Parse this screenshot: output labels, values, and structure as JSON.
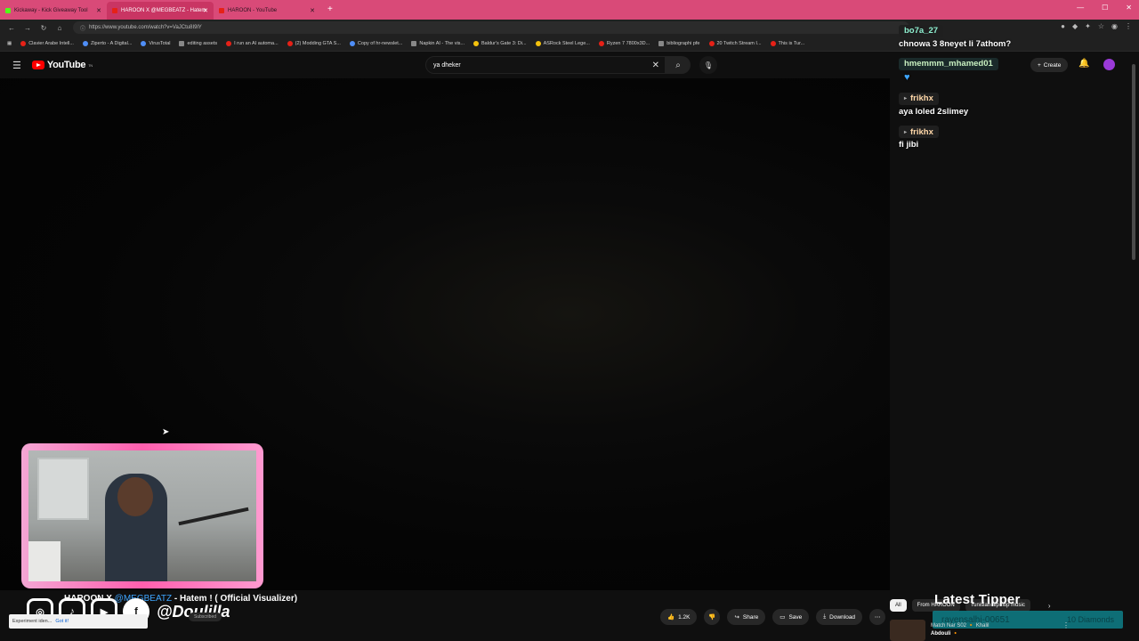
{
  "browser": {
    "tabs": [
      {
        "label": "Kickaway - Kick Giveaway Tool"
      },
      {
        "label": "HAROON X @MEGBEATZ - Hatem"
      },
      {
        "label": "HAROON - YouTube"
      }
    ],
    "url": "https://www.youtube.com/watch?v=VaJCtu8I9lY",
    "bookmarks": [
      "Clavier Arabe Intell...",
      "Ziperto - A Digital...",
      "VirusTotal",
      "editing assets",
      "I run an AI automa...",
      "(2) Modding GTA S...",
      "Copy of hr-newslet...",
      "Napkin AI - The vis...",
      "Baldur's Gate 3: Di...",
      "ASRock Steel Lege...",
      "Ryzen 7 7800x3D...",
      "bibliographi pfe",
      "20 Twitch Stream I...",
      "This is Tur..."
    ]
  },
  "youtube": {
    "logo_text": "YouTube",
    "logo_sup": "TN",
    "search_value": "ya dheker",
    "create_label": "Create"
  },
  "video": {
    "title_prefix": "HAROON X ",
    "title_tag": "@MEGBEATZ",
    "title_suffix": " - Hatem ! ( Official Visualizer)",
    "subscribe_label": "Subscribed",
    "toast_text": "Experiment iden...",
    "toast_action": "Got it!",
    "like_count": "1.2K",
    "share_label": "Share",
    "save_label": "Save",
    "download_label": "Download"
  },
  "overlay": {
    "social_handle": "@Doulilla",
    "latest_tipper_title": "Latest Tipper",
    "tipper_name": "rayensalhi-00651",
    "tipper_amount": "10 Diamonds"
  },
  "chips": {
    "all": "All",
    "from": "From HAROON",
    "tunisian": "Tunisian hip hop music"
  },
  "recommended": {
    "title": "Match Nar S02 🔸 Khalil",
    "channel": "Abdouli 🔸"
  },
  "chat": [
    {
      "user": "bo7a_27",
      "text": "chnowa 3 8neyet li 7athom?"
    },
    {
      "user": "hmemmm_mhamed01",
      "text": ""
    },
    {
      "user": "frikhx",
      "text": "aya loled 2slimey"
    },
    {
      "user": "frikhx",
      "text": "fi jibi"
    }
  ]
}
